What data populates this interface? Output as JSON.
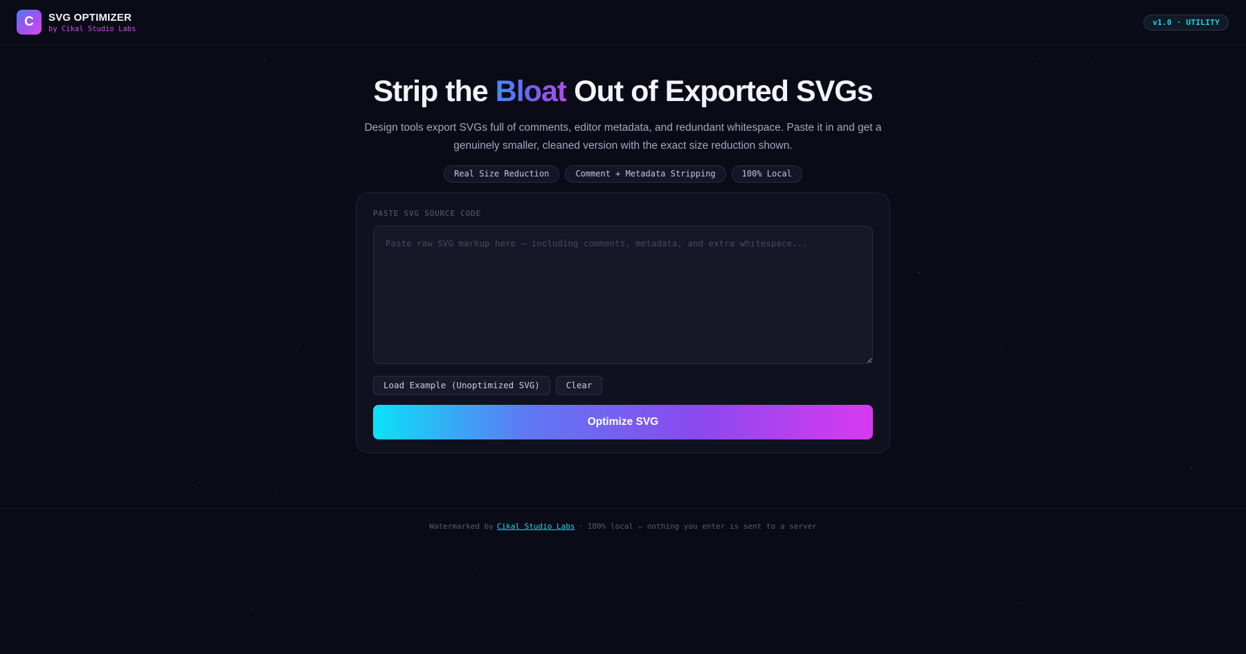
{
  "header": {
    "logo_letter": "C",
    "title": "SVG OPTIMIZER",
    "subtitle": "by Cikal Studio Labs",
    "version_badge": "v1.0 · UTILITY"
  },
  "hero": {
    "title_before": "Strip the",
    "title_accent": "Bloat",
    "title_after": "Out of Exported SVGs",
    "description": "Design tools export SVGs full of comments, editor metadata, and redundant whitespace. Paste it in and get a genuinely smaller, cleaned version with the exact size reduction shown.",
    "chips": [
      "Real Size Reduction",
      "Comment + Metadata Stripping",
      "100% Local"
    ]
  },
  "editor": {
    "label": "PASTE SVG SOURCE CODE",
    "value": "",
    "placeholder": "Paste raw SVG markup here — including comments, metadata, and extra whitespace...",
    "load_example_label": "Load Example (Unoptimized SVG)",
    "clear_label": "Clear",
    "optimize_label": "Optimize SVG"
  },
  "footer": {
    "prefix": "Watermarked by",
    "link_text": "Cikal Studio Labs",
    "suffix": "· 100% local — nothing you enter is sent to a server"
  },
  "colors": {
    "background": "#0a0b17",
    "accent_cyan": "#22d3ee",
    "accent_magenta": "#d946ef",
    "accent_blue": "#3f8ef5"
  }
}
